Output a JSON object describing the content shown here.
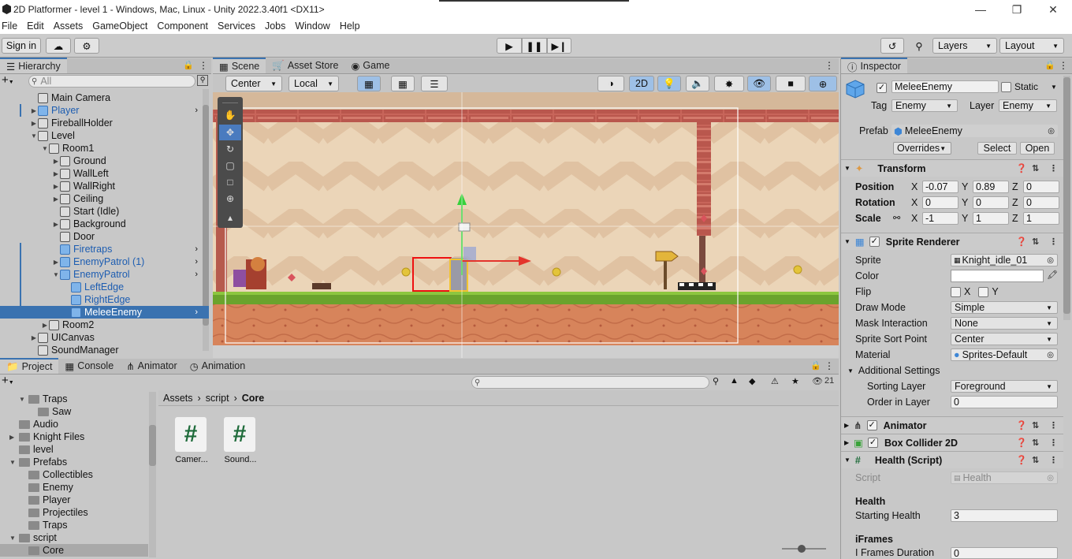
{
  "window": {
    "title": "2D Platformer - level 1 - Windows, Mac, Linux - Unity 2022.3.40f1 <DX11>"
  },
  "menu": [
    "File",
    "Edit",
    "Assets",
    "GameObject",
    "Component",
    "Services",
    "Jobs",
    "Window",
    "Help"
  ],
  "toolbar": {
    "signin": "Sign in",
    "layers": "Layers",
    "layout": "Layout"
  },
  "hierarchy": {
    "tab": "Hierarchy",
    "search_placeholder": "All",
    "items": [
      {
        "label": "Main Camera"
      },
      {
        "label": "Player"
      },
      {
        "label": "FireballHolder"
      },
      {
        "label": "Level"
      },
      {
        "label": "Room1"
      },
      {
        "label": "Ground"
      },
      {
        "label": "WallLeft"
      },
      {
        "label": "WallRight"
      },
      {
        "label": "Ceiling"
      },
      {
        "label": "Start (Idle)"
      },
      {
        "label": "Background"
      },
      {
        "label": "Door"
      },
      {
        "label": "Firetraps"
      },
      {
        "label": "EnemyPatrol (1)"
      },
      {
        "label": "EnemyPatrol"
      },
      {
        "label": "LeftEdge"
      },
      {
        "label": "RightEdge"
      },
      {
        "label": "MeleeEnemy"
      },
      {
        "label": "Room2"
      },
      {
        "label": "UICanvas"
      },
      {
        "label": "SoundManager"
      }
    ]
  },
  "scene": {
    "tabs": [
      "Scene",
      "Asset Store",
      "Game"
    ],
    "pivot": "Center",
    "space": "Local",
    "mode_2d": "2D"
  },
  "project": {
    "tabs": [
      "Project",
      "Console",
      "Animator",
      "Animation"
    ],
    "breadcrumb": [
      "Assets",
      "script",
      "Core"
    ],
    "tree": [
      "Traps",
      "Saw",
      "Audio",
      "Knight Files",
      "level",
      "Prefabs",
      "Collectibles",
      "Enemy",
      "Player",
      "Projectiles",
      "Traps",
      "script",
      "Core"
    ],
    "files": [
      "Camer...",
      "Sound..."
    ],
    "count": "21"
  },
  "inspector": {
    "tab": "Inspector",
    "name": "MeleeEnemy",
    "static_label": "Static",
    "tag_label": "Tag",
    "tag": "Enemy",
    "layer_label": "Layer",
    "layer": "Enemy",
    "prefab_label": "Prefab",
    "prefab": "MeleeEnemy",
    "overrides": "Overrides",
    "select": "Select",
    "open": "Open",
    "transform": {
      "title": "Transform",
      "position_label": "Position",
      "rotation_label": "Rotation",
      "scale_label": "Scale",
      "px": "-0.07",
      "py": "0.89",
      "pz": "0",
      "rx": "0",
      "ry": "0",
      "rz": "0",
      "sx": "-1",
      "sy": "1",
      "sz": "1"
    },
    "sprite_renderer": {
      "title": "Sprite Renderer",
      "sprite_label": "Sprite",
      "sprite": "Knight_idle_01",
      "color_label": "Color",
      "flip_label": "Flip",
      "flip_x": "X",
      "flip_y": "Y",
      "draw_mode_label": "Draw Mode",
      "draw_mode": "Simple",
      "mask_label": "Mask Interaction",
      "mask": "None",
      "sort_point_label": "Sprite Sort Point",
      "sort_point": "Center",
      "material_label": "Material",
      "material": "Sprites-Default",
      "additional": "Additional Settings",
      "sorting_layer_label": "Sorting Layer",
      "sorting_layer": "Foreground",
      "order_label": "Order in Layer",
      "order": "0"
    },
    "animator": "Animator",
    "box_collider": "Box Collider 2D",
    "health": {
      "title": "Health (Script)",
      "script_label": "Script",
      "script": "Health",
      "section": "Health",
      "starting_label": "Starting Health",
      "starting": "3",
      "iframes_section": "iFrames",
      "iframes_label": "I Frames Duration",
      "iframes": "0"
    }
  },
  "colors": {
    "accent": "#3a72b0",
    "scene_bg": "#ead4b6",
    "grass": "#6aa32d"
  }
}
